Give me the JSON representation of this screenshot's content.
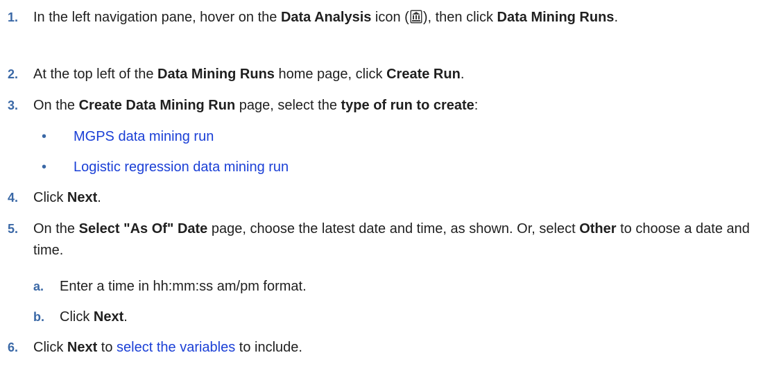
{
  "steps": [
    {
      "num": "1.",
      "text_a": "In the left navigation pane, hover on the ",
      "bold_a": "Data Analysis",
      "text_b": " icon (",
      "icon": "data-analysis-icon",
      "text_c": "), then click ",
      "bold_b": "Data Mining Runs",
      "text_d": "."
    },
    {
      "num": "2.",
      "text_a": "At the top left of the ",
      "bold_a": "Data Mining Runs",
      "text_b": " home page, click ",
      "bold_b": "Create Run",
      "text_c": "."
    },
    {
      "num": "3.",
      "text_a": "On the ",
      "bold_a": "Create Data Mining Run",
      "text_b": " page, select the ",
      "bold_b": "type of run to create",
      "text_c": ":",
      "bullets": [
        {
          "symbol": "•",
          "link": "MGPS data mining run"
        },
        {
          "symbol": "•",
          "link": "Logistic regression data mining run"
        }
      ]
    },
    {
      "num": "4.",
      "text_a": "Click ",
      "bold_a": "Next",
      "text_b": "."
    },
    {
      "num": "5.",
      "text_a": "On the ",
      "bold_a": "Select \"As Of\" Date",
      "text_b": " page, choose the latest date and time, as shown. Or, select ",
      "bold_b": "Other",
      "text_c": " to choose a date and time.",
      "substeps": [
        {
          "letter": "a.",
          "text_a": "Enter a time in hh:mm:ss am/pm format."
        },
        {
          "letter": "b.",
          "text_a": "Click ",
          "bold_a": "Next",
          "text_b": "."
        }
      ]
    },
    {
      "num": "6.",
      "text_a": "Click ",
      "bold_a": "Next",
      "text_b": " to ",
      "link": "select the variables",
      "text_c": " to include."
    }
  ]
}
